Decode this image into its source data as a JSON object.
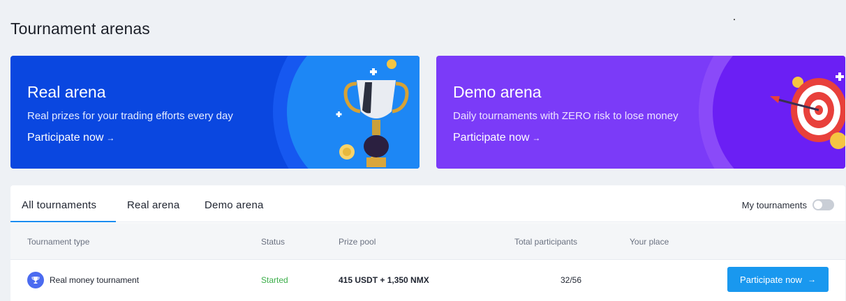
{
  "page": {
    "title": "Tournament arenas"
  },
  "cards": {
    "real": {
      "title": "Real arena",
      "subtitle": "Real prizes for your trading efforts every day",
      "link": "Participate now",
      "arrow": "→",
      "color": "#0a47e0"
    },
    "demo": {
      "title": "Demo arena",
      "subtitle": "Daily tournaments with ZERO risk to lose money",
      "link": "Participate now",
      "arrow": "→",
      "color": "#7b3bf8"
    }
  },
  "tabs": {
    "all": "All tournaments",
    "real": "Real arena",
    "demo": "Demo arena",
    "active": "all"
  },
  "filter": {
    "my_tournaments_label": "My tournaments",
    "my_tournaments_on": false
  },
  "table": {
    "headers": {
      "type": "Tournament type",
      "status": "Status",
      "prize_pool": "Prize pool",
      "participants": "Total participants",
      "place": "Your place"
    },
    "rows": [
      {
        "icon": "trophy-icon",
        "type": "Real money tournament",
        "status": "Started",
        "prize_pool": "415 USDT + 1,350 NMX",
        "participants": "32/56",
        "place": "",
        "action": "Participate now",
        "action_arrow": "→"
      }
    ]
  },
  "colors": {
    "accent": "#1998ef",
    "status_started": "#3cae4a",
    "tab_underline": "#1a8cf0"
  }
}
